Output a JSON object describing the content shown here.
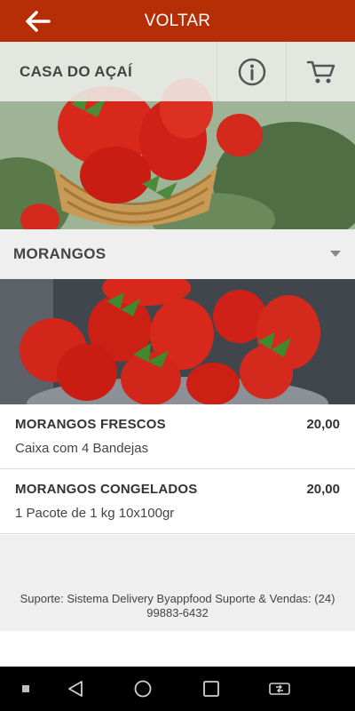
{
  "topbar": {
    "back_label": "VOLTAR"
  },
  "store": {
    "name": "CASA DO AÇAÍ"
  },
  "icons": {
    "back": "arrow-left-icon",
    "info": "info-icon",
    "cart": "cart-icon",
    "dropdown": "caret-down-icon"
  },
  "category": {
    "label": "MORANGOS"
  },
  "products": [
    {
      "name": "MORANGOS FRESCOS",
      "price": "20,00",
      "description": "Caixa com 4 Bandejas"
    },
    {
      "name": "MORANGOS CONGELADOS",
      "price": "20,00",
      "description": "1 Pacote de 1 kg 10x100gr"
    }
  ],
  "support": {
    "text": "Suporte: Sistema Delivery Byappfood Suporte & Vendas: (24) 99883-6432"
  },
  "colors": {
    "topbar": "#b52e06",
    "text": "#444444",
    "panel": "#efefef"
  }
}
